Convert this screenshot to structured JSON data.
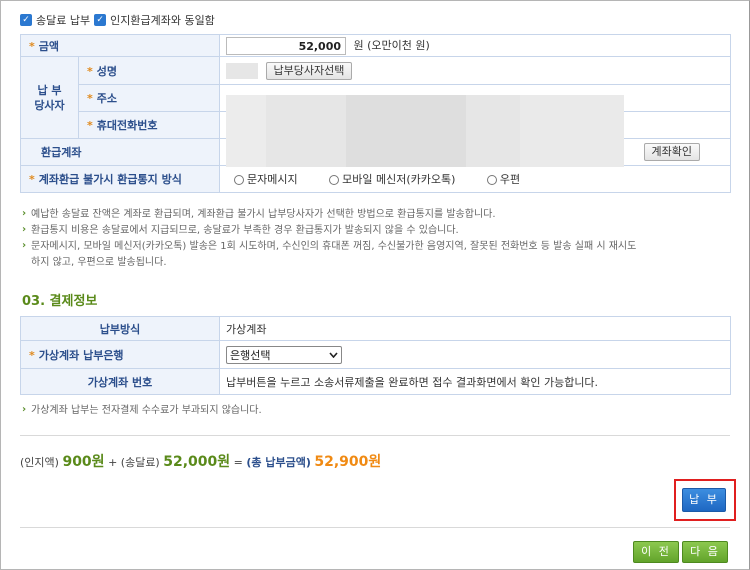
{
  "top_checks": {
    "postage_pay": "송달료 납부",
    "same_as_stamp_account": "인지환급계좌와 동일함"
  },
  "refund_form": {
    "amount_label": "금액",
    "amount_value": "52,000",
    "amount_unit": "원 (오만이천 원)",
    "payer_group_label_line1": "납 부",
    "payer_group_label_line2": "당사자",
    "name_label": "성명",
    "select_payer_button": "납부당사자선택",
    "address_label": "주소",
    "phone_label": "휴대전화번호",
    "account_label": "환급계좌",
    "account_check_button": "계좌확인",
    "method_label": "계좌환급 불가시 환급통지 방식",
    "method_options": [
      "문자메시지",
      "모바일 메신저(카카오톡)",
      "우편"
    ]
  },
  "refund_notes": [
    "예납한 송달료 잔액은 계좌로 환급되며, 계좌환급 불가시 납부당사자가 선택한 방법으로 환급통지를 발송합니다.",
    "환급통지 비용은 송달료에서 지급되므로, 송달료가 부족한 경우 환급통지가 발송되지 않을 수 있습니다.",
    "문자메시지, 모바일 메신저(카카오톡) 발송은 1회 시도하며, 수신인의 휴대폰 꺼짐, 수신불가한 음영지역, 잘못된 전화번호 등 발송 실패 시 재시도",
    "하지 않고, 우편으로 발송됩니다."
  ],
  "section_title": "03. 결제정보",
  "payment_form": {
    "method_label": "납부방식",
    "method_value": "가상계좌",
    "bank_label": "가상계좌 납부은행",
    "bank_select": "은행선택",
    "vaccount_label": "가상계좌 번호",
    "vaccount_value": "납부버튼을 누르고 소송서류제출을 완료하면 접수 결과화면에서 확인 가능합니다."
  },
  "payment_note": "가상계좌 납부는 전자결제 수수료가 부과되지 않습니다.",
  "summary": {
    "stamp_label": "(인지액)",
    "stamp_value": "900원",
    "plus": "+",
    "postage_label": "(송달료)",
    "postage_value": "52,000원",
    "equals": "=",
    "total_label": "(총 납부금액)",
    "total_value": "52,900원"
  },
  "buttons": {
    "pay": "납 부",
    "prev": "이 전",
    "next": "다 음"
  }
}
